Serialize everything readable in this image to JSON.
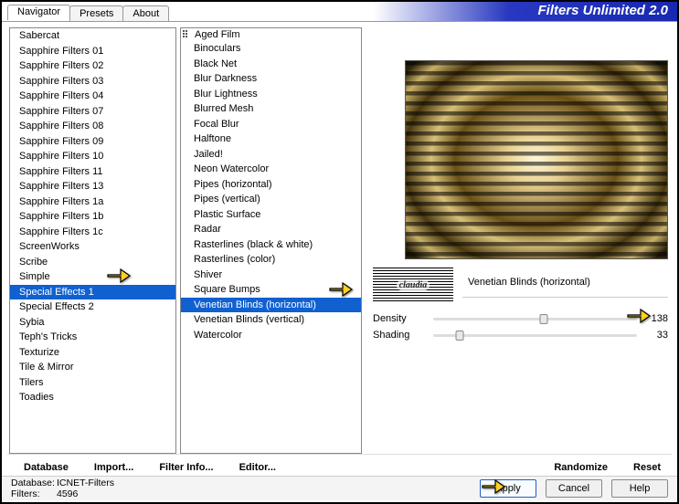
{
  "title": "Filters Unlimited 2.0",
  "tabs": [
    "Navigator",
    "Presets",
    "About"
  ],
  "active_tab": 0,
  "categories": {
    "items": [
      "Sabercat",
      "Sapphire Filters 01",
      "Sapphire Filters 02",
      "Sapphire Filters 03",
      "Sapphire Filters 04",
      "Sapphire Filters 07",
      "Sapphire Filters 08",
      "Sapphire Filters 09",
      "Sapphire Filters 10",
      "Sapphire Filters 11",
      "Sapphire Filters 13",
      "Sapphire Filters 1a",
      "Sapphire Filters 1b",
      "Sapphire Filters 1c",
      "ScreenWorks",
      "Scribe",
      "Simple",
      "Special Effects 1",
      "Special Effects 2",
      "Sybia",
      "Teph's Tricks",
      "Texturize",
      "Tile & Mirror",
      "Tilers",
      "Toadies"
    ],
    "selected": 17
  },
  "filters": {
    "header": "Aged Film",
    "items": [
      "Binoculars",
      "Black Net",
      "Blur Darkness",
      "Blur Lightness",
      "Blurred Mesh",
      "Focal Blur",
      "Halftone",
      "Jailed!",
      "Neon Watercolor",
      "Pipes (horizontal)",
      "Pipes (vertical)",
      "Plastic Surface",
      "Radar",
      "Rasterlines (black & white)",
      "Rasterlines (color)",
      "Shiver",
      "Square Bumps",
      "Venetian Blinds (horizontal)",
      "Venetian Blinds (vertical)",
      "Watercolor"
    ],
    "selected": 17
  },
  "selected_filter_name": "Venetian Blinds (horizontal)",
  "logo_text": "claudia",
  "params": [
    {
      "name": "Density",
      "value": 138,
      "max": 255
    },
    {
      "name": "Shading",
      "value": 33,
      "max": 255
    }
  ],
  "toolbar": {
    "database": "Database",
    "import": "Import...",
    "filter_info": "Filter Info...",
    "editor": "Editor...",
    "randomize": "Randomize",
    "reset": "Reset"
  },
  "status": {
    "db_label": "Database:",
    "db_value": "ICNET-Filters",
    "filters_label": "Filters:",
    "filters_value": "4596"
  },
  "buttons": {
    "apply": "Apply",
    "cancel": "Cancel",
    "help": "Help"
  }
}
